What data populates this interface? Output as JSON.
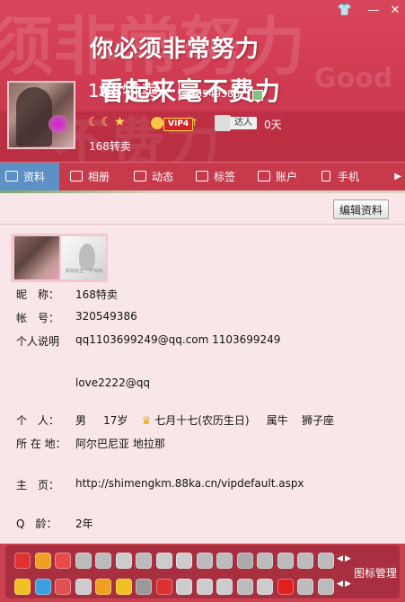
{
  "window": {
    "skin_button": "👕",
    "minimize_button": "—",
    "close_button": "✕"
  },
  "header": {
    "slogan_line1": "你必须非常努力",
    "slogan_line2": "看起来毫不费力",
    "nickname": "168特卖",
    "account_small": "320549386",
    "vip_level": "VIP4",
    "vip_up_arrow": "↑",
    "talent_badge": "达人",
    "days": "0天",
    "signature": "168转卖",
    "moons": "☾☾★"
  },
  "tabs": [
    {
      "label": "资料",
      "icon": "profile-card-icon"
    },
    {
      "label": "相册",
      "icon": "photo-icon"
    },
    {
      "label": "动态",
      "icon": "list-icon"
    },
    {
      "label": "标签",
      "icon": "tag-icon"
    },
    {
      "label": "账户",
      "icon": "briefcase-icon"
    },
    {
      "label": "手机",
      "icon": "phone-icon"
    }
  ],
  "content": {
    "edit_button": "编辑资料",
    "thumb_caption": "如花似玉 一叶知秋",
    "fields": {
      "nickname": {
        "label": "昵　称：",
        "value": "168特卖"
      },
      "account": {
        "label": "帐　号：",
        "value": "320549386"
      },
      "description": {
        "label": "个人说明",
        "value": "qq1103699249@qq.com 1103699249"
      },
      "description2": {
        "label": "",
        "value": "love2222@qq"
      },
      "personal": {
        "label": "个　人：",
        "gender": "男",
        "age": "17岁",
        "birthday": "七月十七(农历生日)",
        "zodiac": "属牛",
        "constellation": "狮子座"
      },
      "location": {
        "label": "所 在 地：",
        "value": "阿尔巴尼亚 地拉那"
      },
      "homepage": {
        "label": "主　页：",
        "value": "http://shimengkm.88ka.cn/vipdefault.aspx"
      },
      "qage": {
        "label": "Q　龄：",
        "value": "2年"
      }
    }
  },
  "footer": {
    "icon_manager": "图标管理",
    "row1_colors": [
      "#e03030",
      "#f0a020",
      "#e84a4a",
      "#bbbbbb",
      "#bbbbbb",
      "#cccccc",
      "#bbbbbb",
      "#cccccc",
      "#cccccc",
      "#bbbbbb",
      "#bbbbbb",
      "#aaaaaa",
      "#bbbbbb",
      "#bbbbbb",
      "#bbbbbb",
      "#bbbbbb"
    ],
    "row2_colors": [
      "#f0c020",
      "#3aa0e0",
      "#e05050",
      "#cccccc",
      "#f0a020",
      "#f0c020",
      "#999999",
      "#dd3030",
      "#cccccc",
      "#cccccc",
      "#cccccc",
      "#bbbbbb",
      "#cccccc",
      "#e02020",
      "#bbbbbb",
      "#bbbbbb"
    ]
  }
}
